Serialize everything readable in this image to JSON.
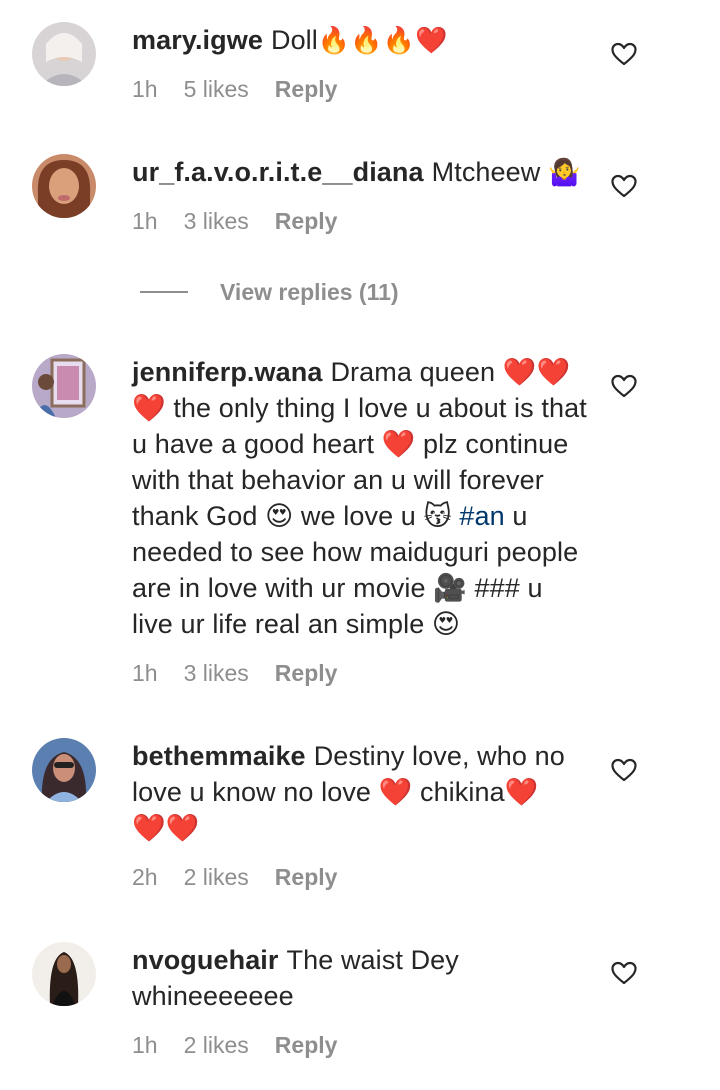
{
  "comments": [
    {
      "username": "mary.igwe",
      "text": "Doll",
      "emojis": "🔥🔥🔥❤️",
      "time": "1h",
      "likes": "5 likes",
      "reply": "Reply"
    },
    {
      "username": "ur_f.a.v.o.r.i.t.e__diana",
      "text": "Mtcheew",
      "emojis": "🤷‍♀️",
      "time": "1h",
      "likes": "3 likes",
      "reply": "Reply"
    },
    {
      "username": "jenniferp.wana",
      "text_parts": [
        "Drama queen ❤️❤️ ❤️ the only thing I love u about is that u have a good heart ❤️ plz continue with that behavior an u will forever thank God 😍 we love u 😽 ",
        "#an",
        " u needed to see how maiduguri people are in love with ur movie 🎥 ### u live ur life real an simple 😍"
      ],
      "time": "1h",
      "likes": "3 likes",
      "reply": "Reply"
    },
    {
      "username": "bethemmaike",
      "text": "Destiny love, who no love u know no love ❤️ chikina❤️ ❤️❤️",
      "time": "2h",
      "likes": "2 likes",
      "reply": "Reply"
    },
    {
      "username": "nvoguehair",
      "text": "The waist Dey whineeeeeee",
      "time": "1h",
      "likes": "2 likes",
      "reply": "Reply"
    }
  ],
  "view_replies": "View replies (11)",
  "icons": {
    "like": "heart-outline-icon"
  },
  "colors": {
    "text": "#262626",
    "meta": "#8e8e8e",
    "hashtag": "#00376b"
  }
}
